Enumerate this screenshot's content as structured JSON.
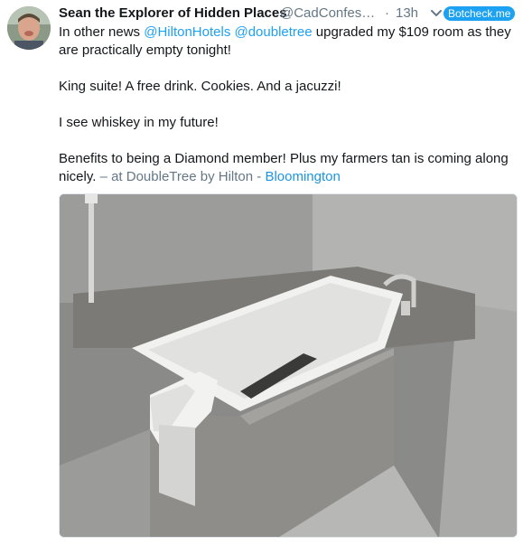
{
  "tweet": {
    "display_name": "Sean the Explorer of Hidden Places",
    "handle": "@CadConfessi…",
    "separator": "·",
    "time": "13h",
    "badge": "Botcheck.me",
    "line1_prefix": "In other news ",
    "mention1": "@HiltonHotels",
    "mention2": "@doubletree",
    "line1_suffix": " upgraded my $109 room as they are practically empty tonight!",
    "para2": "King suite! A free drink. Cookies. And a jacuzzi!",
    "para3": "I see whiskey in my future!",
    "para4": "Benefits to being a Diamond member! Plus my farmers tan is coming along nicely.",
    "location_prefix": " – at DoubleTree by Hilton -  ",
    "location_name": "Bloomington"
  },
  "colors": {
    "accent": "#1da1f2",
    "muted": "#657786",
    "text": "#14171a"
  },
  "icons": {
    "caret": "chevron-down-icon"
  }
}
